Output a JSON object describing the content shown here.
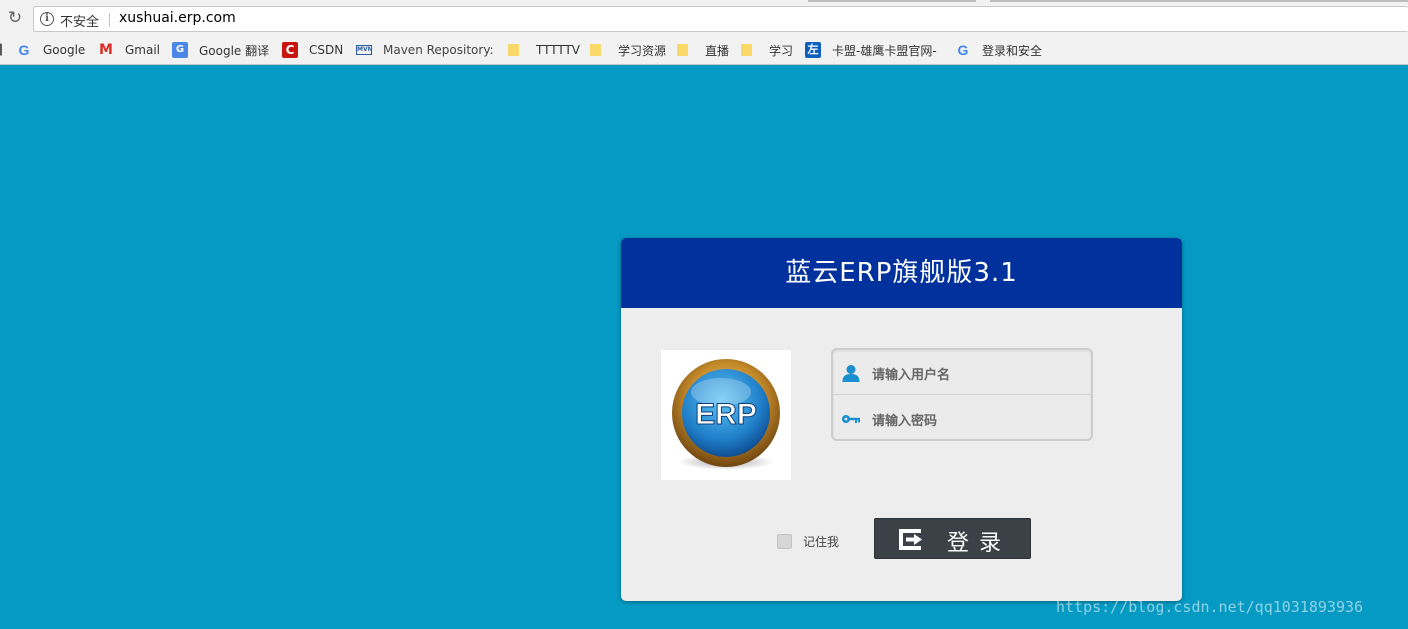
{
  "browser": {
    "security_label": "不安全",
    "url": "xushuai.erp.com",
    "bookmarks": [
      {
        "label": "Google",
        "icon": "google-icon"
      },
      {
        "label": "Gmail",
        "icon": "gmail-icon"
      },
      {
        "label": "Google 翻译",
        "icon": "google-translate-icon"
      },
      {
        "label": "CSDN",
        "icon": "csdn-icon"
      },
      {
        "label": "Maven Repository:",
        "icon": "maven-icon"
      },
      {
        "label": "TTTTTV",
        "icon": "folder-icon"
      },
      {
        "label": "学习资源",
        "icon": "folder-icon"
      },
      {
        "label": "直播",
        "icon": "folder-icon"
      },
      {
        "label": "学习",
        "icon": "folder-icon"
      },
      {
        "label": "卡盟-雄鹰卡盟官网-",
        "icon": "kameng-icon"
      },
      {
        "label": "登录和安全",
        "icon": "google-icon"
      }
    ]
  },
  "login": {
    "title": "蓝云ERP旗舰版3.1",
    "logo_text": "ERP",
    "username_placeholder": "请输入用户名",
    "password_placeholder": "请输入密码",
    "remember_label": "记住我",
    "remember_checked": false,
    "submit_label": "登录"
  },
  "watermark": "https://blog.csdn.net/qq1031893936",
  "colors": {
    "page_background": "#059ac3",
    "header_background": "#00319d",
    "card_background": "#ededed",
    "button_background": "#3c4147"
  }
}
